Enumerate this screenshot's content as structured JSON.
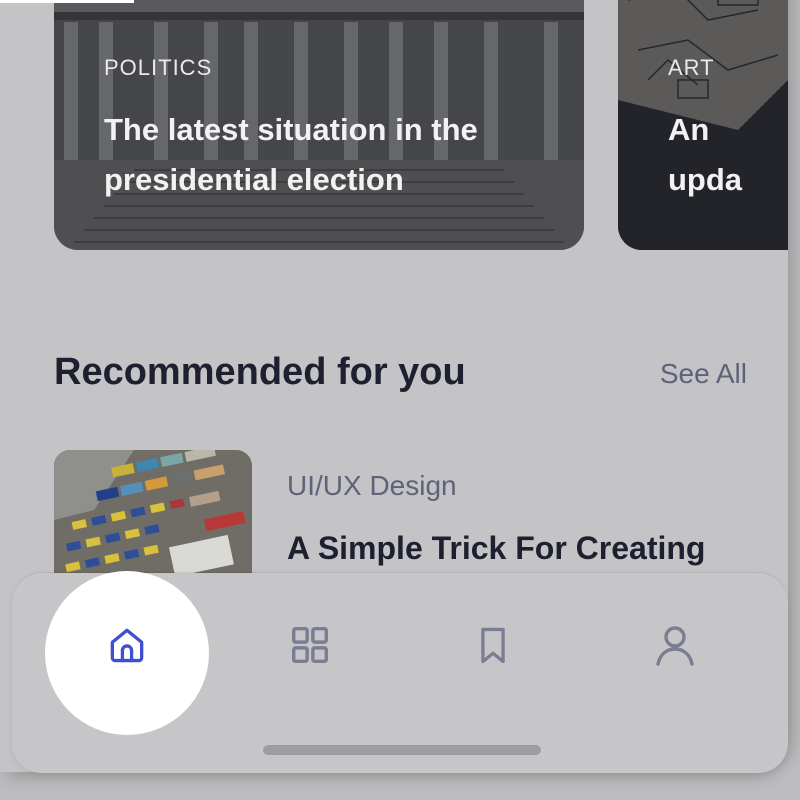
{
  "featured": [
    {
      "category": "POLITICS",
      "title": "The latest situation in the presidential election"
    },
    {
      "category": "ART",
      "title": "An upda page"
    }
  ],
  "recommended": {
    "heading": "Recommended for you",
    "see_all": "See All",
    "items": [
      {
        "category": "UI/UX Design",
        "title": "A Simple Trick For Creating"
      }
    ]
  },
  "bottom_nav": {
    "items": [
      {
        "icon": "home-icon",
        "active": true
      },
      {
        "icon": "grid-icon",
        "active": false
      },
      {
        "icon": "bookmark-icon",
        "active": false
      },
      {
        "icon": "profile-icon",
        "active": false
      }
    ],
    "active_color": "#3e4fd0",
    "inactive_color": "#7b7d92"
  },
  "colors": {
    "heading": "#1e2030",
    "muted": "#5f6278",
    "card_text": "#f2f2f3"
  }
}
